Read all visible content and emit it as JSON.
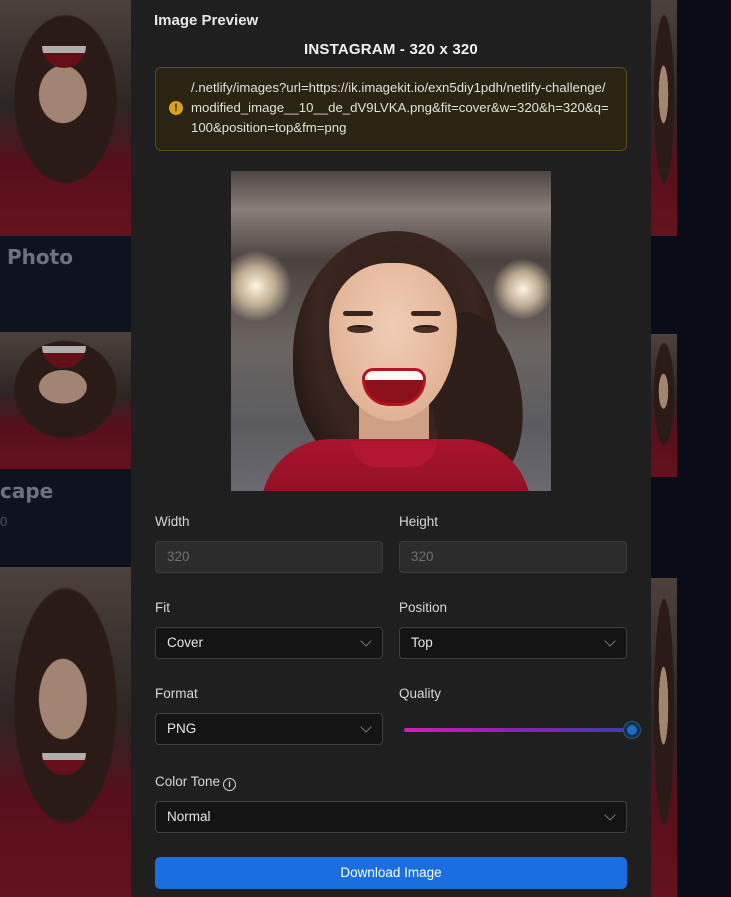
{
  "modal": {
    "title": "Image Preview",
    "preset_title": "INSTAGRAM - 320 x 320",
    "alert_text": "/.netlify/images?url=https://ik.imagekit.io/exn5diy1pdh/netlify-challenge/modified_image__10__de_dV9LVKA.png&fit=cover&w=320&h=320&q=100&position=top&fm=png",
    "width": {
      "label": "Width",
      "placeholder": "320"
    },
    "height": {
      "label": "Height",
      "placeholder": "320"
    },
    "fit": {
      "label": "Fit",
      "value": "Cover"
    },
    "position": {
      "label": "Position",
      "value": "Top"
    },
    "format": {
      "label": "Format",
      "value": "PNG"
    },
    "quality": {
      "label": "Quality",
      "value": 100
    },
    "color_tone": {
      "label": "Color Tone",
      "value": "Normal",
      "icon": "info-icon"
    },
    "download_label": "Download Image"
  },
  "background": {
    "card_titles": [
      "Photo",
      "cape"
    ],
    "card_subtitle": "0"
  },
  "colors": {
    "modal_bg": "#1f1f1f",
    "page_bg": "#0e1322",
    "button_bg": "#1a6ee0",
    "alert_bg": "#2a2413",
    "alert_icon": "#d8a21a",
    "slider_start": "#d41eb8",
    "slider_end": "#3a3fa8"
  }
}
